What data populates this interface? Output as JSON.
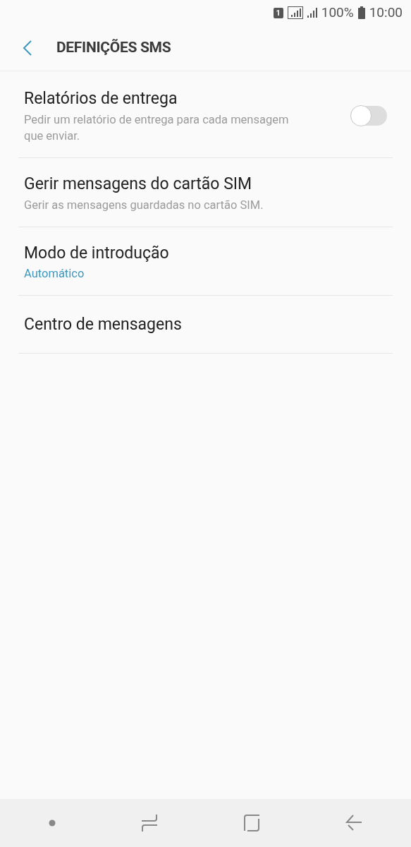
{
  "status_bar": {
    "sim_slot": "1",
    "battery": "100%",
    "time": "10:00"
  },
  "header": {
    "title": "DEFINIÇÕES SMS"
  },
  "settings": [
    {
      "kind": "toggle",
      "title": "Relatórios de entrega",
      "subtitle": "Pedir um relatório de entrega para cada mensagem que enviar.",
      "on": false
    },
    {
      "kind": "action",
      "title": "Gerir mensagens do cartão SIM",
      "subtitle": "Gerir as mensagens guardadas no cartão SIM."
    },
    {
      "kind": "value",
      "title": "Modo de introdução",
      "subtitle": "Automático"
    },
    {
      "kind": "action",
      "title": "Centro de mensagens"
    }
  ]
}
